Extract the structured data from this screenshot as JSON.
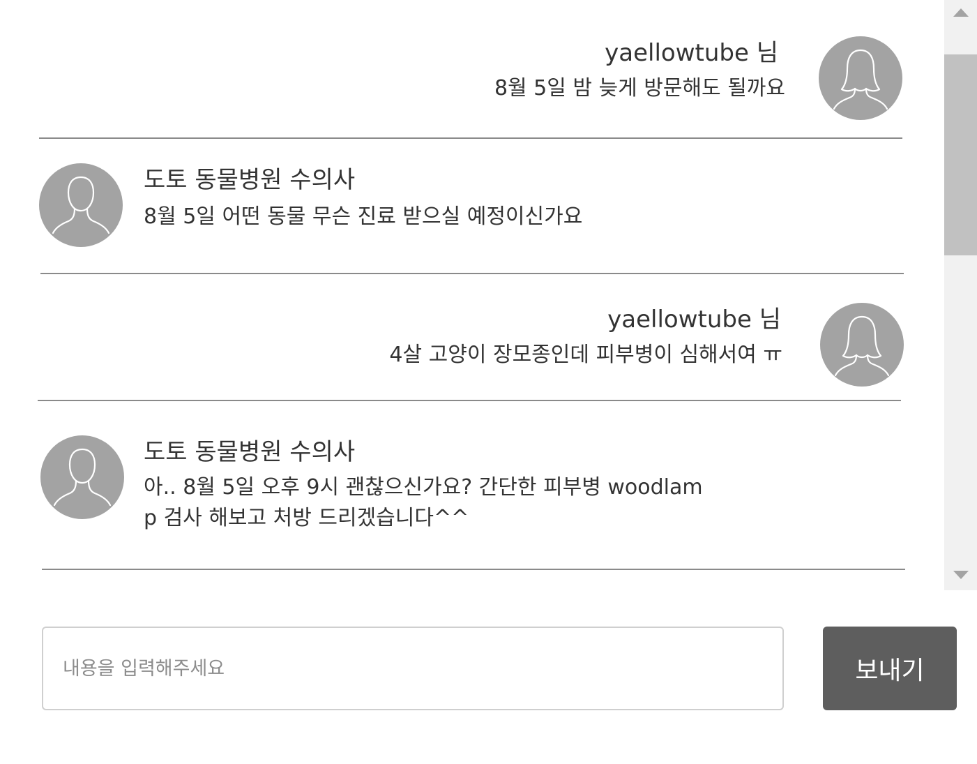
{
  "messages": [
    {
      "side": "right",
      "avatar_icon": "female-user-icon",
      "sender": "yaellowtube 님",
      "lines": [
        "8월 5일 밤 늦게 방문해도 될까요"
      ]
    },
    {
      "side": "left",
      "avatar_icon": "male-user-icon",
      "sender": "도토 동물병원 수의사",
      "lines": [
        "8월 5일 어떤 동물 무슨 진료 받으실 예정이신가요"
      ]
    },
    {
      "side": "right",
      "avatar_icon": "female-user-icon",
      "sender": "yaellowtube 님",
      "lines": [
        "4살 고양이 장모종인데 피부병이 심해서여 ㅠ"
      ]
    },
    {
      "side": "left",
      "avatar_icon": "male-user-icon",
      "sender": "도토 동물병원 수의사",
      "lines": [
        "아.. 8월 5일  오후 9시 괜찮으신가요? 간단한 피부병 woodlam",
        "p 검사 해보고 처방 드리겠습니다^^"
      ]
    }
  ],
  "composer": {
    "placeholder": "내용을 입력해주세요",
    "value": "",
    "send_label": "보내기"
  },
  "colors": {
    "avatar_bg": "#a3a3a3",
    "send_button_bg": "#5e5e5e",
    "divider": "#8a8a8a"
  }
}
